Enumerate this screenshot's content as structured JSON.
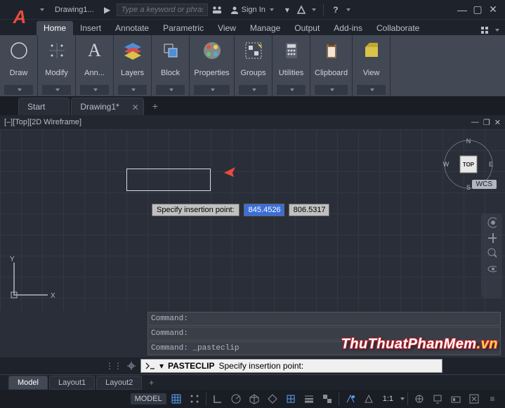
{
  "title": {
    "doc_name": "Drawing1...",
    "search_placeholder": "Type a keyword or phrase",
    "sign_in": "Sign In"
  },
  "ribbon_tabs": [
    "Home",
    "Insert",
    "Annotate",
    "Parametric",
    "View",
    "Manage",
    "Output",
    "Add-ins",
    "Collaborate"
  ],
  "ribbon_panels": [
    {
      "label": "Draw",
      "icon": "circle"
    },
    {
      "label": "Modify",
      "icon": "move"
    },
    {
      "label": "Ann...",
      "icon": "A"
    },
    {
      "label": "Layers",
      "icon": "layers"
    },
    {
      "label": "Block",
      "icon": "block"
    },
    {
      "label": "Properties",
      "icon": "palette"
    },
    {
      "label": "Groups",
      "icon": "groups"
    },
    {
      "label": "Utilities",
      "icon": "calc"
    },
    {
      "label": "Clipboard",
      "icon": "clipboard"
    },
    {
      "label": "View",
      "icon": "folder"
    }
  ],
  "file_tabs": {
    "start": "Start",
    "current": "Drawing1*",
    "plus": "+"
  },
  "viewport": {
    "header": "[–][Top][2D Wireframe]",
    "wcs": "WCS",
    "cube_top": "TOP",
    "compass": [
      "N",
      "E",
      "S",
      "W"
    ]
  },
  "tooltip": {
    "label": "Specify insertion point:",
    "x_value": "845.4526",
    "y_value": "806.5317"
  },
  "command_history": [
    "Command:",
    "Command:",
    "Command: _pasteclip"
  ],
  "command_line": {
    "prefix": "PASTECLIP",
    "text": "Specify insertion point:"
  },
  "layout_tabs": [
    "Model",
    "Layout1",
    "Layout2"
  ],
  "statusbar": {
    "model": "MODEL",
    "scale": "1:1"
  },
  "watermark": {
    "p1": "ThuThuatPhanMem",
    "p2": ".vn"
  }
}
